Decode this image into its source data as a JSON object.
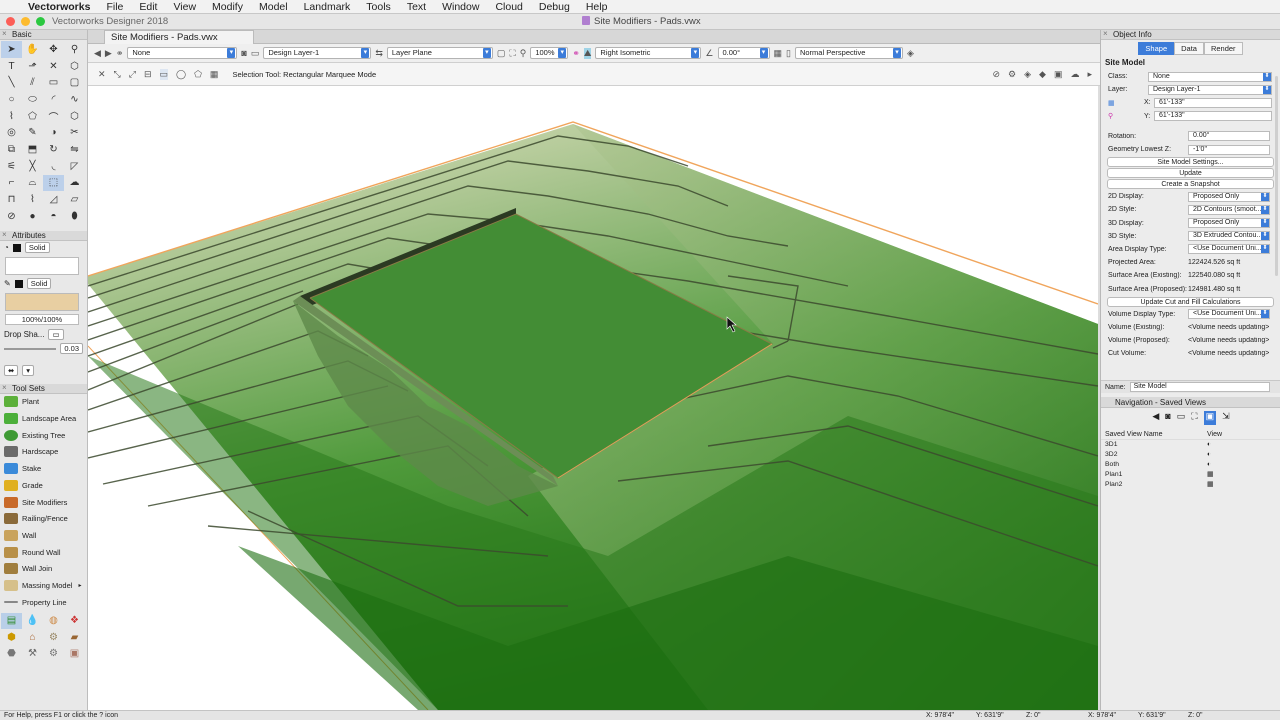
{
  "menubar": {
    "items": [
      "Vectorworks",
      "File",
      "Edit",
      "View",
      "Modify",
      "Model",
      "Landmark",
      "Tools",
      "Text",
      "Window",
      "Cloud",
      "Debug",
      "Help"
    ]
  },
  "window": {
    "app_title": "Vectorworks Designer 2018",
    "doc_title": "Site Modifiers - Pads.vwx",
    "tab": "Site Modifiers - Pads.vwx"
  },
  "viewbar": {
    "class": "None",
    "layer": "Design Layer-1",
    "plane": "Layer Plane",
    "zoom": "100%",
    "view": "Right Isometric",
    "angle": "0.00°",
    "render": "Normal Perspective"
  },
  "modebar": {
    "message": "Selection Tool: Rectangular Marquee Mode"
  },
  "basic": {
    "title": "Basic"
  },
  "attributes": {
    "title": "Attributes",
    "fill_style": "Solid",
    "pen_style": "Solid",
    "opacity": "100%/100%",
    "drop_shadow": "Drop Sha...",
    "line_weight": "0.03",
    "pen_color": "#e8cfa2"
  },
  "toolsets": {
    "title": "Tool Sets",
    "items": [
      "Plant",
      "Landscape Area",
      "Existing Tree",
      "Hardscape",
      "Stake",
      "Grade",
      "Site Modifiers",
      "Railing/Fence",
      "Wall",
      "Round Wall",
      "Wall Join",
      "Massing Model",
      "Property Line"
    ]
  },
  "object_info": {
    "title": "Object Info",
    "tabs": [
      "Shape",
      "Data",
      "Render"
    ],
    "type": "Site Model",
    "class": "None",
    "layer": "Design Layer-1",
    "x": "61'-133\"",
    "y": "61'-133\"",
    "rotation": "0.00°",
    "geometry_lowest_z": "-1'0\"",
    "btn_settings": "Site Model Settings...",
    "btn_update": "Update",
    "btn_snapshot": "Create a Snapshot",
    "display_2d": "Proposed Only",
    "style_2d": "2D Contours (smoot...",
    "display_3d": "Proposed Only",
    "style_3d": "3D Extruded Contou...",
    "area_display_type": "<Use Document Uni...",
    "projected_area": "122424.526  sq ft",
    "surface_existing": "122540.080  sq ft",
    "surface_proposed": "124981.480  sq ft",
    "btn_cutfill": "Update Cut and Fill Calculations",
    "volume_display_type": "<Use Document Uni...",
    "vol_existing": "<Volume needs updating>",
    "vol_proposed": "<Volume needs updating>",
    "cut_volume": "<Volume needs updating>",
    "labels": {
      "class": "Class:",
      "layer": "Layer:",
      "x": "X:",
      "y": "Y:",
      "rotation": "Rotation:",
      "geo_z": "Geometry Lowest Z:",
      "d2": "2D Display:",
      "s2": "2D Style:",
      "d3": "3D Display:",
      "s3": "3D Style:",
      "adt": "Area Display Type:",
      "pa": "Projected Area:",
      "se": "Surface Area (Existing):",
      "sp": "Surface Area (Proposed):",
      "vdt": "Volume Display Type:",
      "ve": "Volume (Existing):",
      "vp": "Volume (Proposed):",
      "cv": "Cut Volume:",
      "name": "Name:"
    },
    "name": "Site Model"
  },
  "navigation": {
    "title": "Navigation - Saved Views",
    "col_name": "Saved View Name",
    "col_view": "View",
    "views": [
      "3D1",
      "3D2",
      "Both",
      "Plan1",
      "Plan2"
    ]
  },
  "status": {
    "help": "For Help, press F1 or click the ? icon",
    "x": "X: 978'4\"",
    "y": "Y: 631'9\"",
    "z": "Z: 0\"",
    "x2": "X: 978'4\"",
    "y2": "Y: 631'9\"",
    "z2": "Z: 0\""
  },
  "colors": {
    "accent": "#3c7cd9",
    "terrain_light": "#a8c48e",
    "terrain_dark": "#2f7a1f",
    "pad": "#3f8a34",
    "orange": "#f0a55c"
  }
}
